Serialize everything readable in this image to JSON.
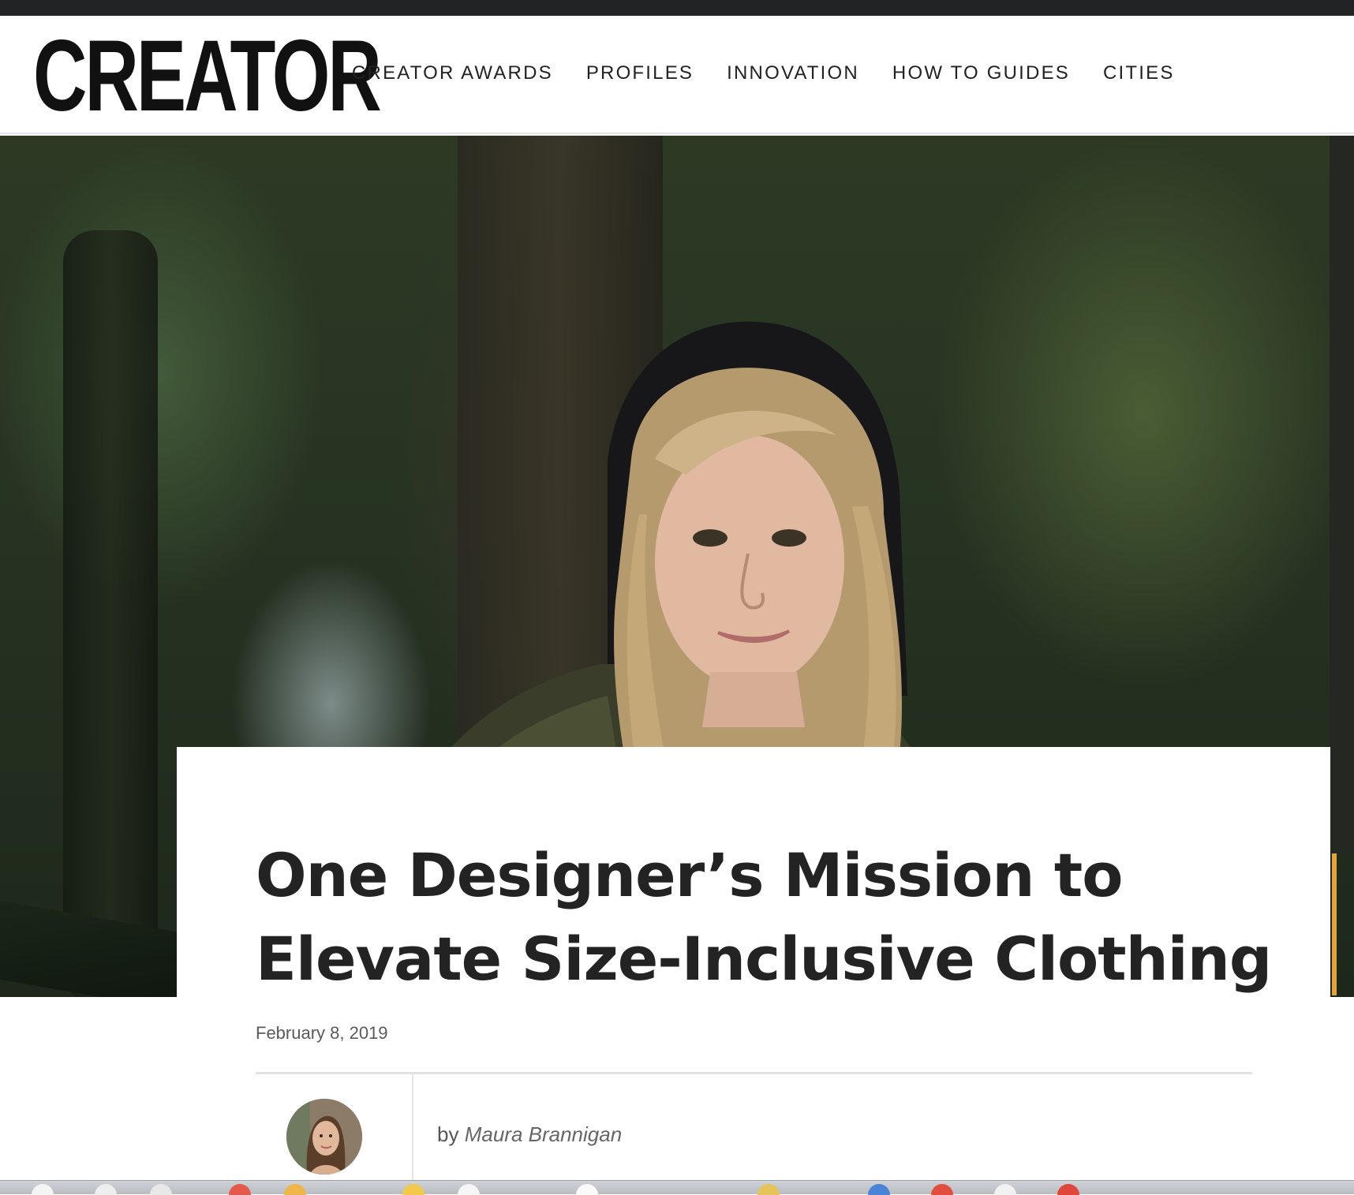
{
  "site": {
    "logo_text": "CREATOR"
  },
  "nav": {
    "items": [
      {
        "label": "CREATOR AWARDS"
      },
      {
        "label": "PROFILES"
      },
      {
        "label": "INNOVATION"
      },
      {
        "label": "HOW TO GUIDES"
      },
      {
        "label": "CITIES"
      }
    ]
  },
  "article": {
    "headline_line1": "One Designer’s Mission to",
    "headline_line2": "Elevate Size-Inclusive Clothing",
    "date": "February 8, 2019",
    "byline_prefix": "by",
    "author": "Maura Brannigan"
  },
  "colors": {
    "top_strip": "#222325",
    "accent": "#e3a43b",
    "text_dark": "#232323"
  }
}
